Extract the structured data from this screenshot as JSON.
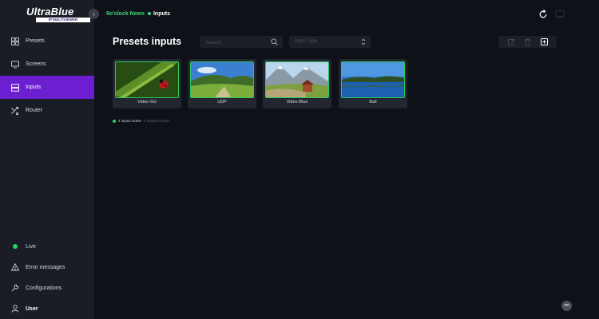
{
  "app": {
    "logo_text": "UltraBlue",
    "logo_subtext": "IP MULTIVIEWER"
  },
  "sidebar": {
    "collapse_glyph": "‹",
    "items": [
      {
        "label": "Presets",
        "icon": "grid-icon"
      },
      {
        "label": "Screens",
        "icon": "monitor-icon"
      },
      {
        "label": "Inputs",
        "icon": "server-icon",
        "active": true
      },
      {
        "label": "Router",
        "icon": "shuffle-icon"
      }
    ],
    "bottom": {
      "live_label": "Live",
      "error_label": "Error messages",
      "config_label": "Configurations",
      "user_label": "User"
    }
  },
  "header": {
    "breadcrumb_root": "9o'clock News",
    "breadcrumb_current": "Inputs"
  },
  "main": {
    "title": "Presets inputs",
    "search_placeholder": "Search",
    "type_select": "Input Type",
    "status_active": "4 inputs active",
    "status_inactive": "0 stopped inputs"
  },
  "inputs": [
    {
      "name": "Video-SG",
      "scene": "ladybug"
    },
    {
      "name": "UDP",
      "scene": "meadow"
    },
    {
      "name": "Video-Blue",
      "scene": "alpine-house"
    },
    {
      "name": "Ball",
      "scene": "lake"
    }
  ],
  "colors": {
    "accent": "#6c1fd1",
    "live_green": "#21d46b",
    "card_border": "#2fc75e"
  },
  "language": "en"
}
